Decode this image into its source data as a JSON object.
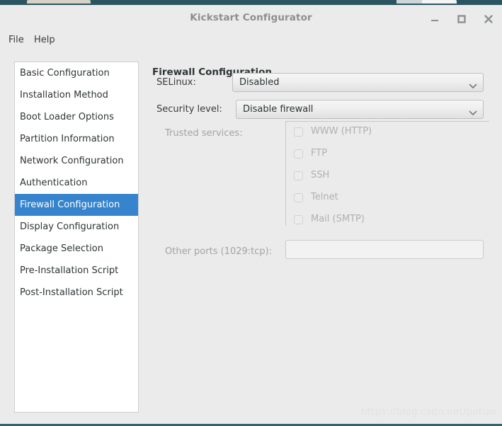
{
  "window": {
    "title": "Kickstart Configurator",
    "controls": {
      "minimize": "minimize-icon",
      "maximize": "maximize-icon",
      "close": "close-icon"
    }
  },
  "menubar": {
    "items": [
      {
        "label": "File"
      },
      {
        "label": "Help"
      }
    ]
  },
  "sidebar": {
    "items": [
      {
        "label": "Basic Configuration",
        "selected": false
      },
      {
        "label": "Installation Method",
        "selected": false
      },
      {
        "label": "Boot Loader Options",
        "selected": false
      },
      {
        "label": "Partition Information",
        "selected": false
      },
      {
        "label": "Network Configuration",
        "selected": false
      },
      {
        "label": "Authentication",
        "selected": false
      },
      {
        "label": "Firewall Configuration",
        "selected": true
      },
      {
        "label": "Display Configuration",
        "selected": false
      },
      {
        "label": "Package Selection",
        "selected": false
      },
      {
        "label": "Pre-Installation Script",
        "selected": false
      },
      {
        "label": "Post-Installation Script",
        "selected": false
      }
    ]
  },
  "panel": {
    "title": "Firewall Configuration",
    "selinux": {
      "label": "SELinux:",
      "value": "Disabled",
      "arrow_icon": "chevron-down-icon"
    },
    "security_level": {
      "label": "Security level:",
      "value": "Disable firewall",
      "arrow_icon": "chevron-down-icon"
    },
    "trusted_services": {
      "label": "Trusted services:",
      "items": [
        {
          "label": "WWW (HTTP)",
          "checked": false
        },
        {
          "label": "FTP",
          "checked": false
        },
        {
          "label": "SSH",
          "checked": false
        },
        {
          "label": "Telnet",
          "checked": false
        },
        {
          "label": "Mail (SMTP)",
          "checked": false
        }
      ]
    },
    "other_ports": {
      "label": "Other ports (1029:tcp):",
      "value": "",
      "placeholder": ""
    }
  },
  "watermark": {
    "text": "https://blog.csdn.net/potizo"
  },
  "colors": {
    "selection": "#3584cd",
    "window_bg": "#ebebeb",
    "list_bg": "#ffffff",
    "disabled_text": "#b0b0b0",
    "desktop": "#2b5560"
  }
}
